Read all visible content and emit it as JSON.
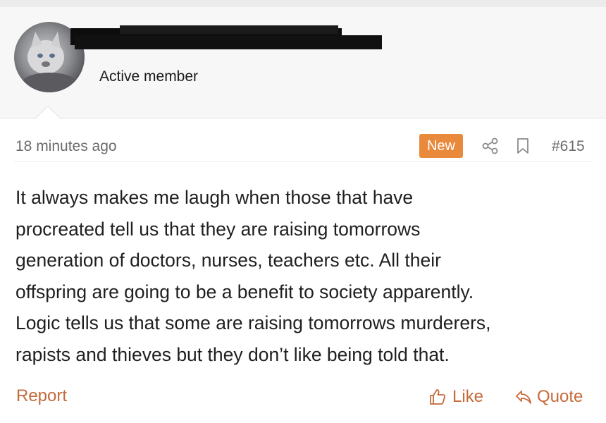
{
  "user": {
    "title": "Active member"
  },
  "post": {
    "timestamp": "18 minutes ago",
    "badge": "New",
    "number": "#615",
    "paragraphs": [
      "It always makes me laugh when those that have",
      "procreated tell us that they are raising tomorrows",
      "generation of doctors, nurses, teachers etc. All their",
      "offspring are going to be a benefit to society apparently.",
      "Logic tells us that some are raising tomorrows murderers,",
      "rapists and thieves but they don’t like being told that."
    ]
  },
  "actions": {
    "report": "Report",
    "like": "Like",
    "quote": "Quote"
  },
  "icons": {
    "share": "share-icon",
    "bookmark": "bookmark-icon",
    "like": "thumbs-up-icon",
    "quote": "reply-arrow-icon"
  },
  "colors": {
    "badge": "#e9893b",
    "link": "#c56a3a",
    "meta_text": "#6b6b6b",
    "header_bg": "#f7f7f7"
  }
}
